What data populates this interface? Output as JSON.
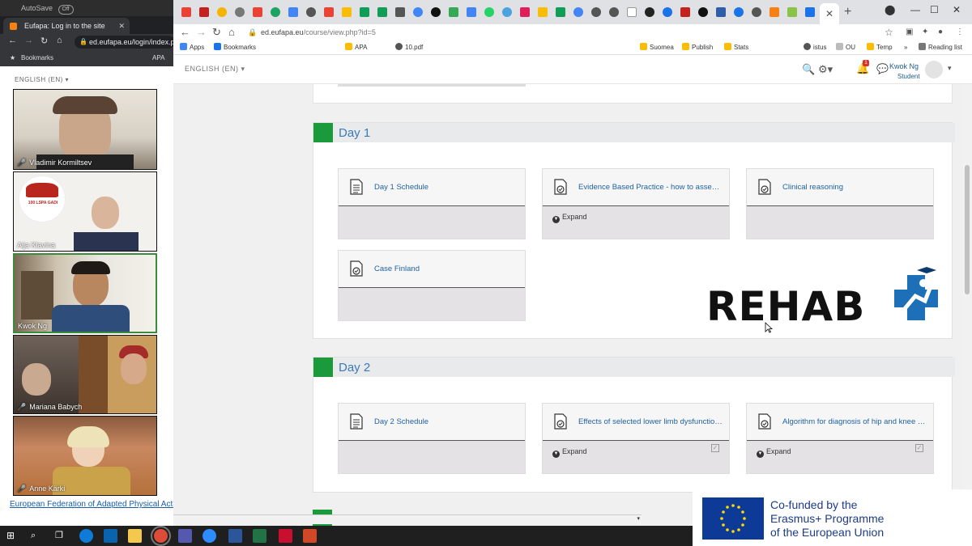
{
  "left_window": {
    "autosave_label": "AutoSave",
    "autosave_toggle": "Off",
    "tab_title": "Eufapa: Log in to the site",
    "url": "ed.eufapa.eu/login/index.p",
    "bookmarks_label": "Bookmarks",
    "bookmark_apa": "APA",
    "language": "ENGLISH (EN)",
    "footer_link": "European Federation of Adapted Physical Activity"
  },
  "participants": [
    {
      "name": "Vladimir Kormiltsev",
      "muted": true
    },
    {
      "name": "Aija Klavina",
      "muted": false
    },
    {
      "name": "Kwok Ng",
      "muted": false
    },
    {
      "name": "Mariana Babych",
      "muted": true
    },
    {
      "name": "Anne Kärki",
      "muted": true
    }
  ],
  "participant_logo_text": "100 LSPA GADI",
  "browser": {
    "url_domain": "ed.eufapa.eu",
    "url_path": "/course/view.php?id=5",
    "bookmarks": [
      "Apps",
      "Bookmarks",
      "APA",
      "10.pdf",
      "Suomea",
      "Publish",
      "Stats",
      "istus",
      "OU",
      "Temp",
      "Reading list"
    ]
  },
  "header": {
    "language": "ENGLISH (EN)",
    "user_name": "Kwok Ng",
    "user_role": "Student",
    "notification_count": "1"
  },
  "sections": [
    {
      "title": "Day 1",
      "activities": [
        {
          "title": "Day 1 Schedule",
          "expand": false
        },
        {
          "title": "Evidence Based Practice - how to assess the patient",
          "expand": true
        },
        {
          "title": "Clinical reasoning",
          "expand": false
        },
        {
          "title": "Case Finland",
          "expand": false
        }
      ]
    },
    {
      "title": "Day 2",
      "activities": [
        {
          "title": "Day 2 Schedule",
          "expand": false
        },
        {
          "title": "Effects of selected lower limb dysfunctions",
          "expand": true
        },
        {
          "title": "Algorithm for diagnosis of hip and knee osteoarthritis",
          "expand": true
        }
      ]
    }
  ],
  "expand_label": "Expand",
  "rehab_logo_text": "REHAB",
  "eu_banner": {
    "line1": "Co-funded by the",
    "line2": "Erasmus+ Programme",
    "line3": "of the European Union"
  },
  "colors": {
    "section_mark": "#1a9a3a",
    "link": "#1f62a2",
    "eu_blue": "#0d3a96",
    "eu_star": "#ffdd00"
  }
}
